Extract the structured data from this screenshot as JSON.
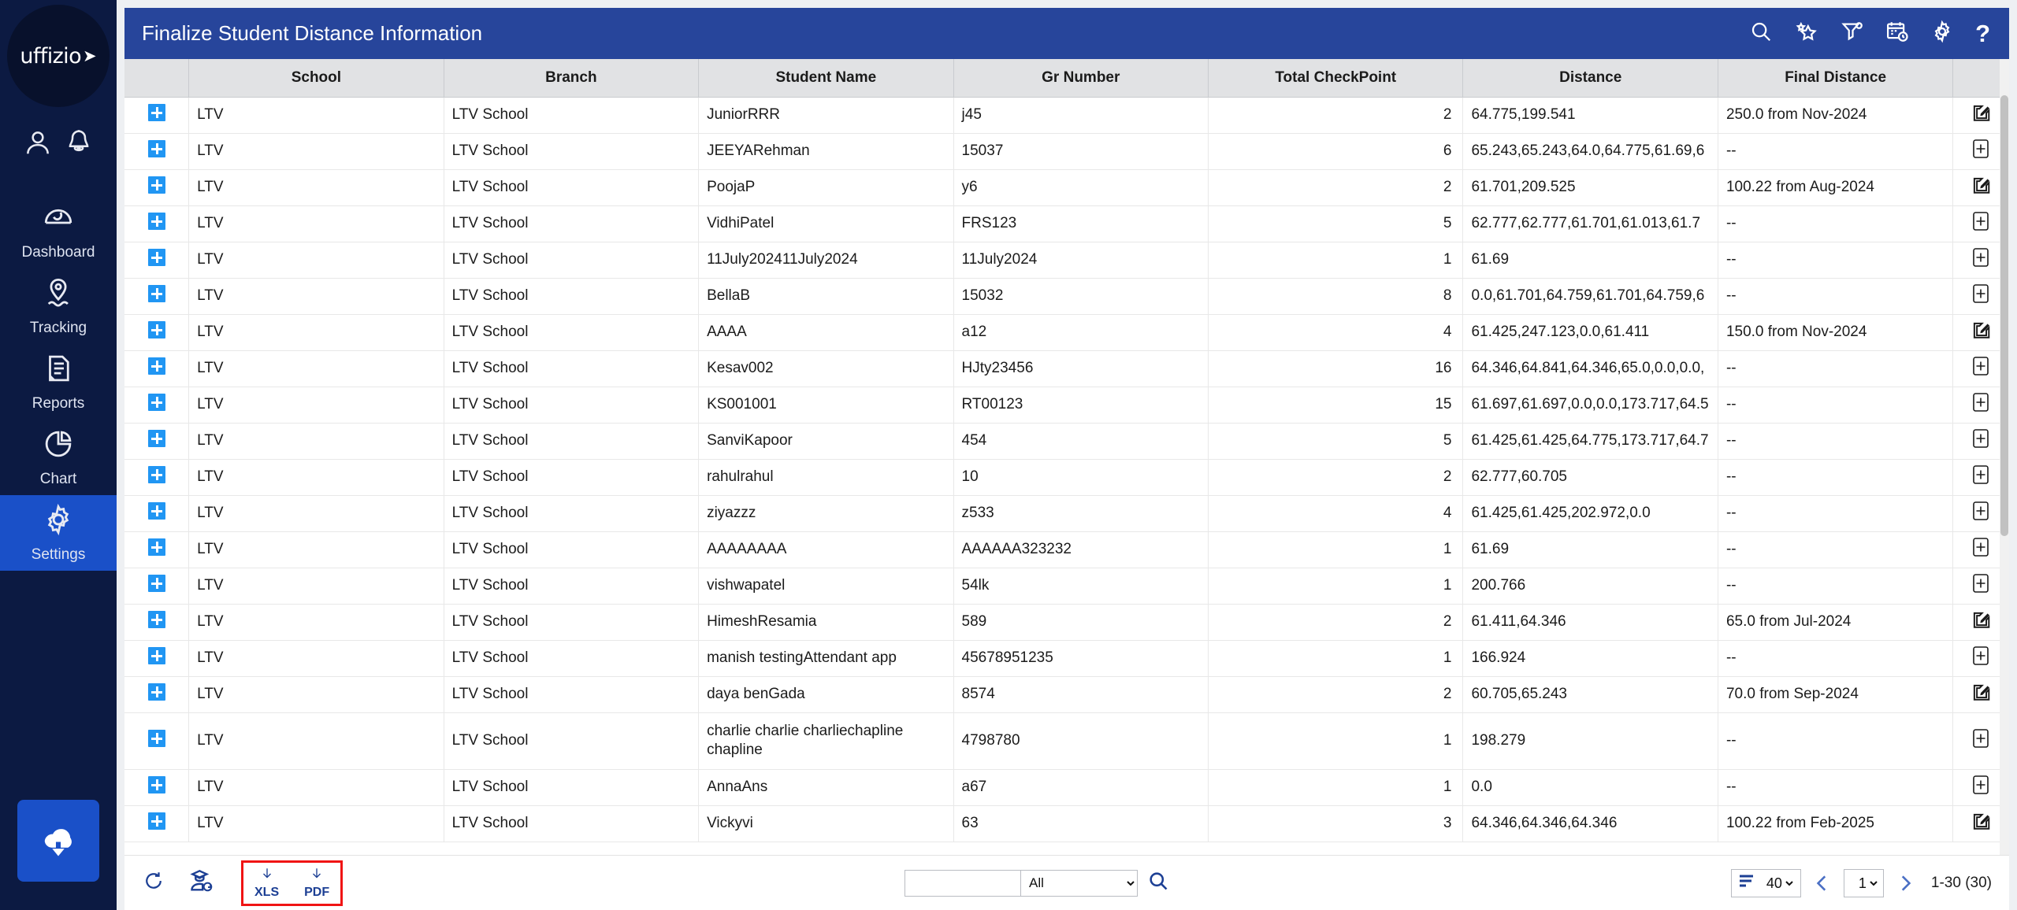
{
  "sidebar": {
    "logo": "uffizio",
    "top_icons": [
      {
        "name": "user-icon"
      },
      {
        "name": "bell-icon"
      }
    ],
    "items": [
      {
        "label": "Dashboard",
        "icon": "dashboard-icon",
        "active": false
      },
      {
        "label": "Tracking",
        "icon": "location-pin-icon",
        "active": false
      },
      {
        "label": "Reports",
        "icon": "document-icon",
        "active": false
      },
      {
        "label": "Chart",
        "icon": "pie-chart-icon",
        "active": false
      },
      {
        "label": "Settings",
        "icon": "gear-icon",
        "active": true
      }
    ],
    "cloud_button": "cloud-download-icon"
  },
  "header": {
    "title": "Finalize Student Distance Information",
    "icons": [
      {
        "name": "search-icon"
      },
      {
        "name": "star-favorite-icon"
      },
      {
        "name": "filter-icon"
      },
      {
        "name": "calendar-clock-icon"
      },
      {
        "name": "gear-icon"
      },
      {
        "name": "help-icon",
        "glyph": "?"
      }
    ]
  },
  "table": {
    "columns": [
      "",
      "School",
      "Branch",
      "Student Name",
      "Gr Number",
      "Total CheckPoint",
      "Distance",
      "Final Distance",
      ""
    ],
    "rows": [
      {
        "school": "LTV",
        "branch": "LTV School",
        "student": "JuniorRRR",
        "gr": "j45",
        "checkpoints": "2",
        "distance": "64.775,199.541",
        "final": "250.0 from Nov-2024",
        "action": "edit-icon"
      },
      {
        "school": "LTV",
        "branch": "LTV School",
        "student": "JEEYARehman",
        "gr": "15037",
        "checkpoints": "6",
        "distance": "65.243,65.243,64.0,64.775,61.69,6",
        "final": "--",
        "action": "add-icon"
      },
      {
        "school": "LTV",
        "branch": "LTV School",
        "student": "PoojaP",
        "gr": "y6",
        "checkpoints": "2",
        "distance": "61.701,209.525",
        "final": "100.22 from Aug-2024",
        "action": "edit-icon"
      },
      {
        "school": "LTV",
        "branch": "LTV School",
        "student": "VidhiPatel",
        "gr": "FRS123",
        "checkpoints": "5",
        "distance": "62.777,62.777,61.701,61.013,61.7",
        "final": "--",
        "action": "add-icon"
      },
      {
        "school": "LTV",
        "branch": "LTV School",
        "student": "11July202411July2024",
        "gr": "11July2024",
        "checkpoints": "1",
        "distance": "61.69",
        "final": "--",
        "action": "add-icon"
      },
      {
        "school": "LTV",
        "branch": "LTV School",
        "student": "BellaB",
        "gr": "15032",
        "checkpoints": "8",
        "distance": "0.0,61.701,64.759,61.701,64.759,6",
        "final": "--",
        "action": "add-icon"
      },
      {
        "school": "LTV",
        "branch": "LTV School",
        "student": "AAAA",
        "gr": "a12",
        "checkpoints": "4",
        "distance": "61.425,247.123,0.0,61.411",
        "final": "150.0 from Nov-2024",
        "action": "edit-icon"
      },
      {
        "school": "LTV",
        "branch": "LTV School",
        "student": "Kesav002",
        "gr": "HJty23456",
        "checkpoints": "16",
        "distance": "64.346,64.841,64.346,65.0,0.0,0.0,",
        "final": "--",
        "action": "add-icon"
      },
      {
        "school": "LTV",
        "branch": "LTV School",
        "student": "KS001001",
        "gr": "RT00123",
        "checkpoints": "15",
        "distance": "61.697,61.697,0.0,0.0,173.717,64.5",
        "final": "--",
        "action": "add-icon"
      },
      {
        "school": "LTV",
        "branch": "LTV School",
        "student": "SanviKapoor",
        "gr": "454",
        "checkpoints": "5",
        "distance": "61.425,61.425,64.775,173.717,64.7",
        "final": "--",
        "action": "add-icon"
      },
      {
        "school": "LTV",
        "branch": "LTV School",
        "student": "rahulrahul",
        "gr": "10",
        "checkpoints": "2",
        "distance": "62.777,60.705",
        "final": "--",
        "action": "add-icon"
      },
      {
        "school": "LTV",
        "branch": "LTV School",
        "student": "ziyazzz",
        "gr": "z533",
        "checkpoints": "4",
        "distance": "61.425,61.425,202.972,0.0",
        "final": "--",
        "action": "add-icon"
      },
      {
        "school": "LTV",
        "branch": "LTV School",
        "student": "AAAAAAAA",
        "gr": "AAAAAA323232",
        "checkpoints": "1",
        "distance": "61.69",
        "final": "--",
        "action": "add-icon"
      },
      {
        "school": "LTV",
        "branch": "LTV School",
        "student": "vishwapatel",
        "gr": "54lk",
        "checkpoints": "1",
        "distance": "200.766",
        "final": "--",
        "action": "add-icon"
      },
      {
        "school": "LTV",
        "branch": "LTV School",
        "student": "HimeshResamia",
        "gr": "589",
        "checkpoints": "2",
        "distance": "61.411,64.346",
        "final": "65.0 from Jul-2024",
        "action": "edit-icon"
      },
      {
        "school": "LTV",
        "branch": "LTV School",
        "student": "manish testingAttendant app",
        "gr": "45678951235",
        "checkpoints": "1",
        "distance": "166.924",
        "final": "--",
        "action": "add-icon"
      },
      {
        "school": "LTV",
        "branch": "LTV School",
        "student": "daya benGada",
        "gr": "8574",
        "checkpoints": "2",
        "distance": "60.705,65.243",
        "final": "70.0 from Sep-2024",
        "action": "edit-icon"
      },
      {
        "school": "LTV",
        "branch": "LTV School",
        "student": "charlie charlie charliechapline chapline",
        "gr": "4798780",
        "checkpoints": "1",
        "distance": "198.279",
        "final": "--",
        "action": "add-icon",
        "tall": true
      },
      {
        "school": "LTV",
        "branch": "LTV School",
        "student": "AnnaAns",
        "gr": "a67",
        "checkpoints": "1",
        "distance": "0.0",
        "final": "--",
        "action": "add-icon"
      },
      {
        "school": "LTV",
        "branch": "LTV School",
        "student": "Vickyvi",
        "gr": "63",
        "checkpoints": "3",
        "distance": "64.346,64.346,64.346",
        "final": "100.22 from Feb-2025",
        "action": "edit-icon"
      }
    ]
  },
  "footer": {
    "refresh_icon": "refresh-icon",
    "student_sync_icon": "student-sync-icon",
    "export_xls_label": "XLS",
    "export_pdf_label": "PDF",
    "search_value": "",
    "search_placeholder": "",
    "filter_selected": "All",
    "filter_options": [
      "All"
    ],
    "search_button_icon": "search-icon",
    "page_size": "40",
    "page_size_options": [
      "40"
    ],
    "current_page": "1",
    "page_options": [
      "1"
    ],
    "range_text": "1-30 (30)"
  },
  "colors": {
    "sidebar_bg": "#0c1a42",
    "accent_blue": "#1a50c8",
    "header_blue": "#27459b",
    "highlight_red": "#f01414",
    "plus_blue": "#2196f3"
  }
}
